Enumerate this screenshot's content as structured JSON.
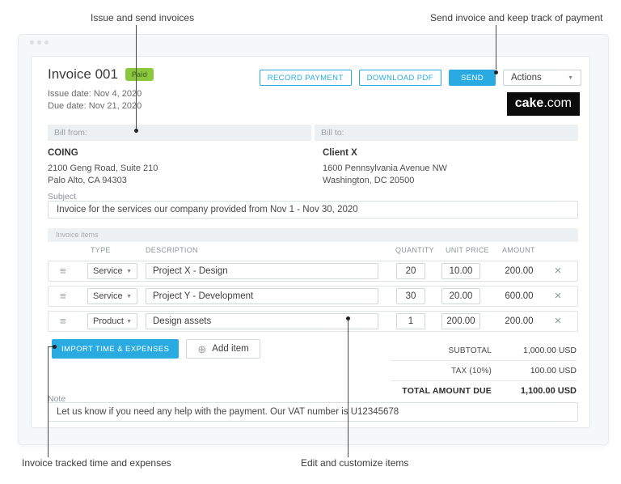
{
  "annotations": {
    "top_left": "Issue and send invoices",
    "top_right": "Send invoice and keep track of payment",
    "bottom_left": "Invoice tracked time and expenses",
    "bottom_center": "Edit and customize items"
  },
  "header": {
    "title": "Invoice 001",
    "status_badge": "Paid",
    "issue_date": "Issue date: Nov 4, 2020",
    "due_date": "Due date: Nov 21, 2020",
    "buttons": {
      "record_payment": "RECORD PAYMENT",
      "download_pdf": "DOWNLOAD PDF",
      "send": "SEND",
      "actions": "Actions"
    },
    "logo": {
      "bold": "cake",
      "domain": ".com"
    }
  },
  "billing": {
    "from_label": "Bill from:",
    "to_label": "Bill to:",
    "from": {
      "name": "COING",
      "line1": "2100 Geng Road, Suite 210",
      "line2": "Palo Alto, CA 94303"
    },
    "to": {
      "name": "Client X",
      "line1": "1600 Pennsylvania Avenue NW",
      "line2": "Washington, DC 20500"
    }
  },
  "subject": {
    "label": "Subject",
    "value": "Invoice for the services our company provided from Nov 1 - Nov 30, 2020"
  },
  "items": {
    "section_label": "Invoice items",
    "columns": [
      "TYPE",
      "DESCRIPTION",
      "QUANTITY",
      "UNIT PRICE",
      "AMOUNT"
    ],
    "rows": [
      {
        "type": "Service",
        "description": "Project X - Design",
        "quantity": "20",
        "unit_price": "10.00",
        "amount": "200.00"
      },
      {
        "type": "Service",
        "description": "Project Y - Development",
        "quantity": "30",
        "unit_price": "20.00",
        "amount": "600.00"
      },
      {
        "type": "Product",
        "description": "Design assets",
        "quantity": "1",
        "unit_price": "200.00",
        "amount": "200.00"
      }
    ],
    "import_button": "IMPORT TIME & EXPENSES",
    "add_item_button": "Add item"
  },
  "totals": {
    "subtotal_label": "SUBTOTAL",
    "subtotal_value": "1,000.00 USD",
    "tax_label": "TAX (10%)",
    "tax_value": "100.00 USD",
    "total_label": "TOTAL AMOUNT DUE",
    "total_value": "1,100.00 USD"
  },
  "note": {
    "label": "Note",
    "value": "Let us know if you need any help with the payment. Our VAT number is U12345678"
  },
  "icons": {
    "drag_handle": "≡",
    "delete": "×",
    "add": "⊕",
    "caret": "▼"
  },
  "colors": {
    "accent_blue": "#29abe2",
    "paid_green": "#8dc63f",
    "logo_bg": "#0c0c0c"
  }
}
